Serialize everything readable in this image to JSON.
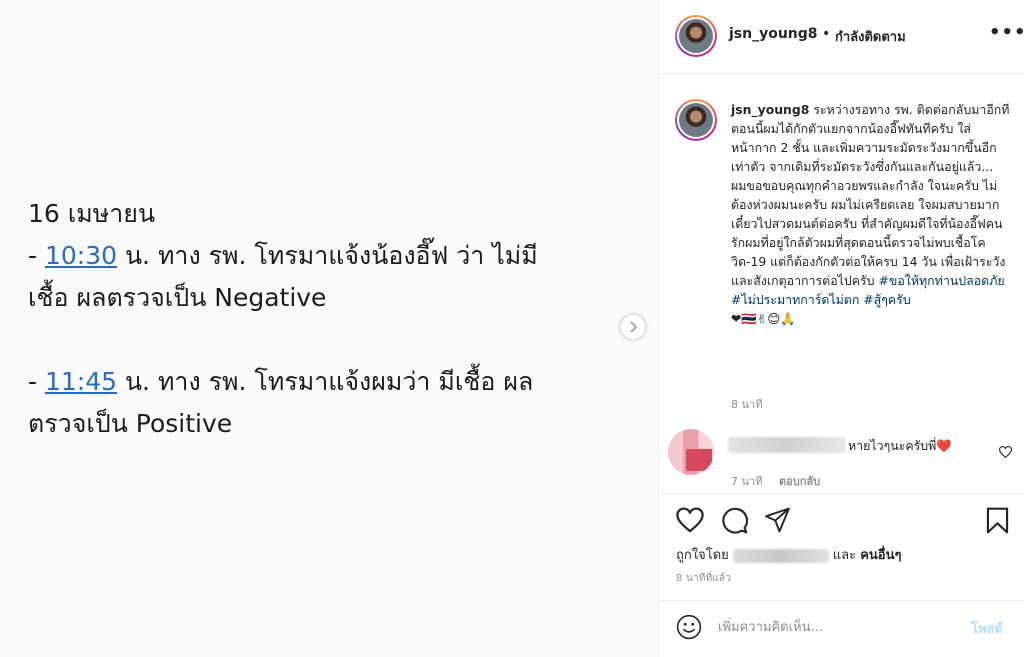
{
  "media": {
    "lines": [
      "16 เมษายน",
      {
        "prefix": "- ",
        "time": "10:30",
        "rest": " น. ทาง รพ. โทรมาแจ้งน้องอี๊ฟ ว่า ไม่มี"
      },
      "เชื้อ ผลตรวจเป็น Negative",
      {
        "prefix": "- ",
        "time": "11:45",
        "rest": " น. ทาง รพ. โทรมาแจ้งผมว่า มีเชื้อ ผล"
      },
      "ตรวจเป็น Positive"
    ],
    "next_icon": "chevron-right-icon"
  },
  "header": {
    "username": "jsn_young8",
    "dot": "•",
    "follow_status": "กำลังติดตาม",
    "more_icon": "more-horizontal-icon",
    "more_label": "•••"
  },
  "caption": {
    "username": "jsn_young8",
    "text": " ระหว่างรอทาง รพ. ติดต่อกลับมาอีกที ตอนนี้ผมได้กักตัวแยกจากน้องอี๊ฟทันทีครับ ใส่หน้ากาก 2 ชั้น และเพิ่มความระมัดระวังมากขึ้นอีกเท่าตัว จากเดิมที่ระมัดระวังซึ่งกันและกันอยู่แล้ว... ผมขอขอบคุณทุกคำอวยพรและกำลัง ใจนะครับ ไม่ต้องห่วงผมนะครับ ผมไม่เครียดเลย ใจผมสบายมาก เดี๋ยวไปสวดมนต์ต่อครับ ที่สำคัญผมดีใจที่น้องอี๊ฟคนรักผมที่อยู่ใกล้ตัวผมที่สุดตอนนี้ตรวจไม่พบเชื้อโควิด-19 แต่ก็ต้องกักตัวต่อให้ครบ 14 วัน เพื่อเฝ้าระวังและสังเกตุอาการต่อไปครับ ",
    "hashtags": "#ขอให้ทุกท่านปลอดภัย #ไม่ประมาทการ์ดไม่ตก #สู้ๆครับ",
    "emojis": "❤🇹🇭✌😊🙏",
    "time": "8 นาที"
  },
  "comment": {
    "text": "หายไวๆนะครับพี่❤️",
    "time": "7 นาที",
    "reply_label": "ตอบกลับ",
    "heart_icon": "heart-outline-icon"
  },
  "actions": {
    "icons": [
      "heart-outline-icon",
      "comment-icon",
      "share-icon",
      "bookmark-icon"
    ]
  },
  "likes": {
    "prefix": "ถูกใจโดย",
    "middle": "และ",
    "others": "คนอื่นๆ"
  },
  "post_time": "8 นาทีที่แล้ว",
  "comment_box": {
    "placeholder": "เพิ่มความคิดเห็น...",
    "post_label": "โพสต์",
    "emoji_icon": "smiley-icon"
  },
  "colors": {
    "link_blue": "#2b6bc7",
    "hashtag": "#00376b",
    "post_button": "#b2dffc"
  }
}
